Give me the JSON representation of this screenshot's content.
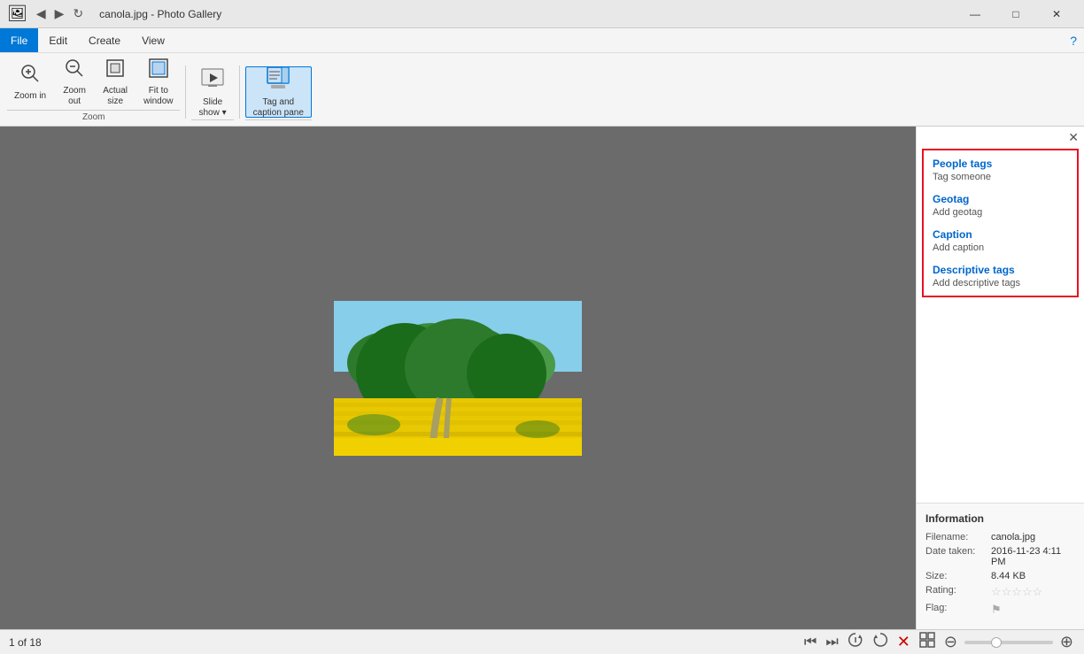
{
  "titleBar": {
    "title": "canola.jpg - Photo Gallery",
    "minimize": "—",
    "maximize": "□",
    "close": "✕"
  },
  "menuBar": {
    "items": [
      "File",
      "Edit",
      "Create",
      "View"
    ]
  },
  "ribbon": {
    "groups": [
      {
        "label": "Zoom",
        "buttons": [
          {
            "id": "zoom-in",
            "icon": "🔍+",
            "label": "Zoom\nin"
          },
          {
            "id": "zoom-out",
            "icon": "🔍-",
            "label": "Zoom\nout"
          },
          {
            "id": "actual-size",
            "icon": "⊡",
            "label": "Actual\nsize"
          },
          {
            "id": "fit-window",
            "icon": "⊞",
            "label": "Fit to\nwindow"
          }
        ]
      },
      {
        "label": "",
        "buttons": [
          {
            "id": "slideshow",
            "icon": "▷",
            "label": "Slide\nshow ▾"
          }
        ]
      },
      {
        "label": "",
        "buttons": [
          {
            "id": "tag-caption",
            "icon": "🏷",
            "label": "Tag and\ncaption pane",
            "active": true
          }
        ]
      }
    ]
  },
  "rightPanel": {
    "sections": [
      {
        "id": "people-tags",
        "title": "People tags",
        "subtitle": "Tag someone"
      },
      {
        "id": "geotag",
        "title": "Geotag",
        "subtitle": "Add geotag"
      },
      {
        "id": "caption",
        "title": "Caption",
        "subtitle": "Add caption"
      },
      {
        "id": "descriptive-tags",
        "title": "Descriptive tags",
        "subtitle": "Add descriptive tags"
      }
    ]
  },
  "info": {
    "title": "Information",
    "filename_label": "Filename:",
    "filename_value": "canola.jpg",
    "date_label": "Date taken:",
    "date_value": "2016-11-23  4:11 PM",
    "size_label": "Size:",
    "size_value": "8.44 KB",
    "rating_label": "Rating:",
    "rating_value": "☆☆☆☆☆",
    "flag_label": "Flag:",
    "flag_value": "⚑"
  },
  "statusBar": {
    "position": "1 of 18"
  }
}
